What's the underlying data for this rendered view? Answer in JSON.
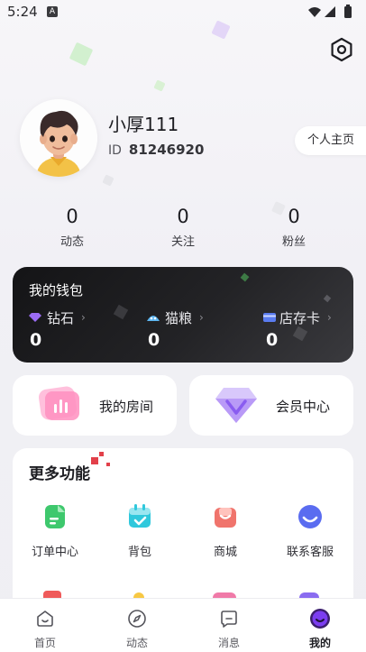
{
  "status_bar": {
    "time": "5:24",
    "notification_letter": "A"
  },
  "profile": {
    "name": "小厚111",
    "id_label": "ID",
    "id_value": "81246920",
    "homepage_button": "个人主页"
  },
  "stats": [
    {
      "value": "0",
      "label": "动态"
    },
    {
      "value": "0",
      "label": "关注"
    },
    {
      "value": "0",
      "label": "粉丝"
    }
  ],
  "wallet": {
    "title": "我的钱包",
    "items": [
      {
        "label": "钻石",
        "value": "0",
        "icon": "diamond-icon"
      },
      {
        "label": "猫粮",
        "value": "0",
        "icon": "cat-food-icon"
      },
      {
        "label": "店存卡",
        "value": "0",
        "icon": "card-icon"
      }
    ],
    "chevron": "›"
  },
  "cards": {
    "room": {
      "label": "我的房间",
      "icon": "room-icon"
    },
    "vip": {
      "label": "会员中心",
      "icon": "vip-diamond-icon"
    }
  },
  "more": {
    "title": "更多功能",
    "functions": [
      {
        "label": "订单中心",
        "icon": "order-icon",
        "color": "#3ec86d"
      },
      {
        "label": "背包",
        "icon": "backpack-icon",
        "color": "#30c8dc"
      },
      {
        "label": "商城",
        "icon": "mall-bag-icon",
        "color": "#f0746c"
      },
      {
        "label": "联系客服",
        "icon": "customer-service-icon",
        "color": "#5a6cf0"
      }
    ]
  },
  "nav": [
    {
      "label": "首页",
      "icon": "home-icon",
      "active": false
    },
    {
      "label": "动态",
      "icon": "compass-icon",
      "active": false
    },
    {
      "label": "消息",
      "icon": "message-icon",
      "active": false
    },
    {
      "label": "我的",
      "icon": "me-icon",
      "active": true
    }
  ],
  "colors": {
    "accent": "#7b3df0",
    "wallet_bg": "#1a1a1c",
    "page_bg": "#f3f2f6"
  }
}
